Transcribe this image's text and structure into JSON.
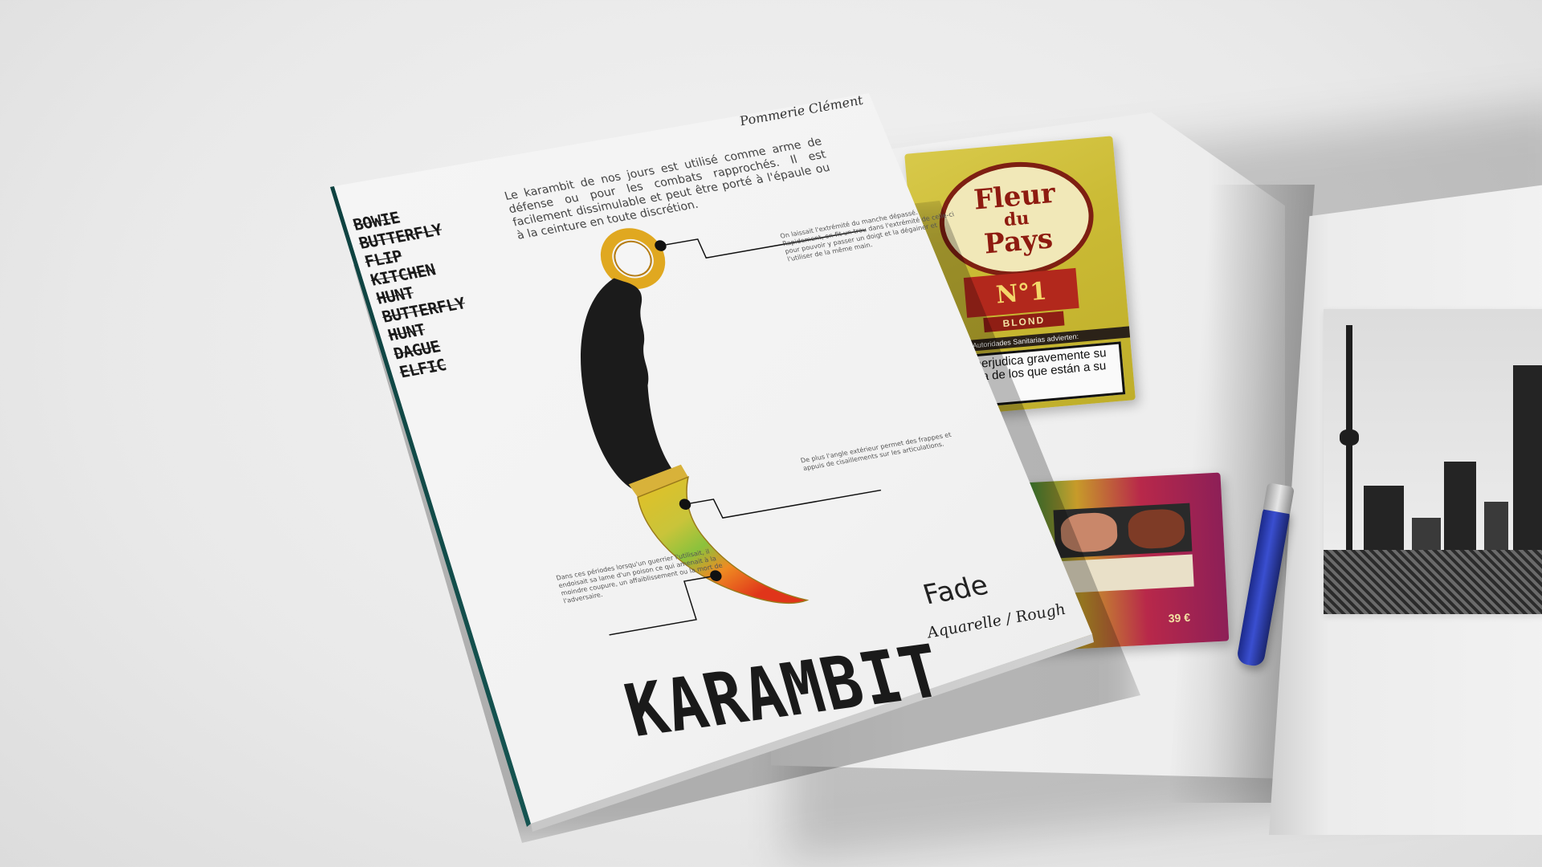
{
  "cover": {
    "author": "Pommerie Clément",
    "knife_list": [
      "BOWIE",
      "BUTTERFLY",
      "FLIP",
      "KITCHEN",
      "HUNT",
      "BUTTERFLY",
      "HUNT",
      "DAGUE",
      "ELFIC"
    ],
    "intro": "Le karambit de nos jours est utilisé comme arme de défense ou pour les combats rapprochés. Il est facilement dissimulable et peut être porté à l'épaule ou à la ceinture en toute discrétion.",
    "callouts": [
      "On laissait l'extrémité du manche dépassé. Rapidement, on fit un trou dans l'extrémité de celle-ci pour pouvoir y passer un doigt et la dégainer et l'utiliser de la même main.",
      "De plus l'angle extérieur permet des frappes et appuis de cisaillements sur les articulations.",
      "Dans ces périodes lorsqu'un guerrier l'utilisait, il endoisait sa lame d'un poison ce qui amenait à la moindre coupure, un affaiblissement ou la mort de l'adversaire."
    ],
    "title": "KARAMBIT",
    "subtitle": "Fade",
    "technique": "Aquarelle / Rough"
  },
  "open_magazine": {
    "tobacco_brand_line1": "Fleur",
    "tobacco_brand_line2": "du",
    "tobacco_brand_line3": "Pays",
    "tobacco_number": "N°1",
    "tobacco_variant": "BLOND",
    "tobacco_authority": "Autoridades Sanitarias advierten:",
    "tobacco_warning": "Fumar perjudica gravemente su salud y la de los que están a su alrededor",
    "pack2_price": "39 €"
  },
  "colors": {
    "cover_spine": "#165653",
    "knife_handle": "#1b1b1b",
    "blade_yellow": "#e2c026",
    "blade_red": "#e0351a",
    "tobacco_yellow": "#cbbb35",
    "tobacco_red": "#b2281c",
    "lighter_blue": "#3a4fd0"
  }
}
